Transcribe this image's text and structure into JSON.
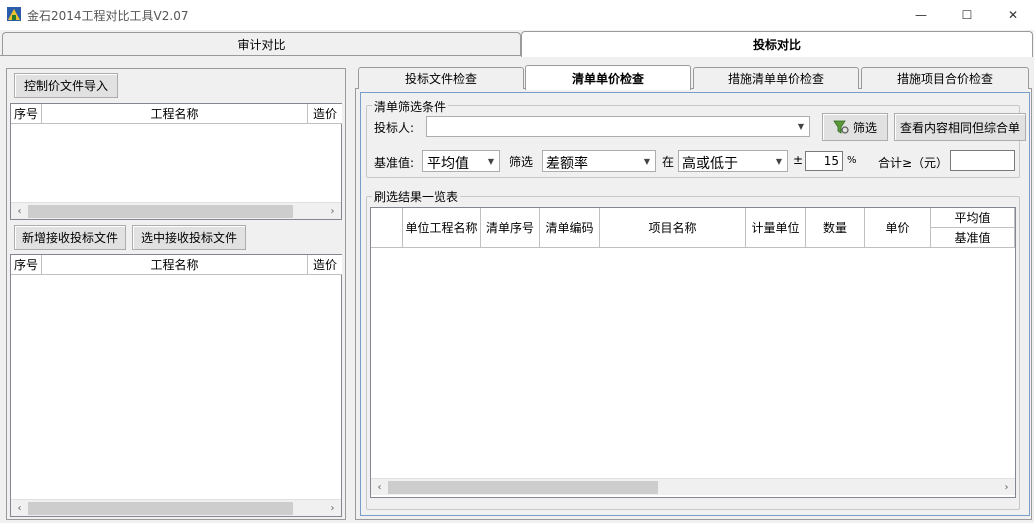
{
  "window": {
    "title": "金石2014工程对比工具V2.07",
    "minimize_glyph": "—",
    "maximize_glyph": "☐",
    "close_glyph": "✕"
  },
  "main_tabs": [
    {
      "label": "审计对比",
      "active": false
    },
    {
      "label": "投标对比",
      "active": true
    }
  ],
  "left_panel": {
    "import_button": "控制价文件导入",
    "control_grid": {
      "columns": [
        "序号",
        "工程名称",
        "造价"
      ]
    },
    "add_bid_button": "新增接收投标文件",
    "select_bid_button": "选中接收投标文件",
    "bid_grid": {
      "columns": [
        "序号",
        "工程名称",
        "造价"
      ]
    },
    "scroll_left": "‹",
    "scroll_right": "›"
  },
  "sub_tabs": [
    {
      "label": "投标文件检查",
      "active": false
    },
    {
      "label": "清单单价检查",
      "active": true
    },
    {
      "label": "措施清单单价检查",
      "active": false
    },
    {
      "label": "措施项目合价检查",
      "active": false
    }
  ],
  "filter": {
    "group_title": "清单筛选条件",
    "bidder_label": "投标人:",
    "bidder_value": "",
    "filter_button": "筛选",
    "view_button": "查看内容相同但综合单",
    "base_label": "基准值:",
    "base_value": "平均值",
    "filter_label": "筛选",
    "filter_value": "差额率",
    "at_label": "在",
    "condition_value": "高或低于",
    "plusminus": "±",
    "percent_value": "15",
    "percent_unit": "%",
    "total_label": "合计≥（元）",
    "total_value": ""
  },
  "results": {
    "group_title": "刷选结果一览表",
    "columns": [
      "单位工程名称",
      "清单序号",
      "清单编码",
      "项目名称",
      "计量单位",
      "数量",
      "单价"
    ],
    "split_header": {
      "top": "平均值",
      "bottom": "基准值"
    }
  },
  "colors": {
    "tab_active": "#ffffff",
    "bg": "#f0f0f0",
    "border": "#9a9a9a"
  }
}
